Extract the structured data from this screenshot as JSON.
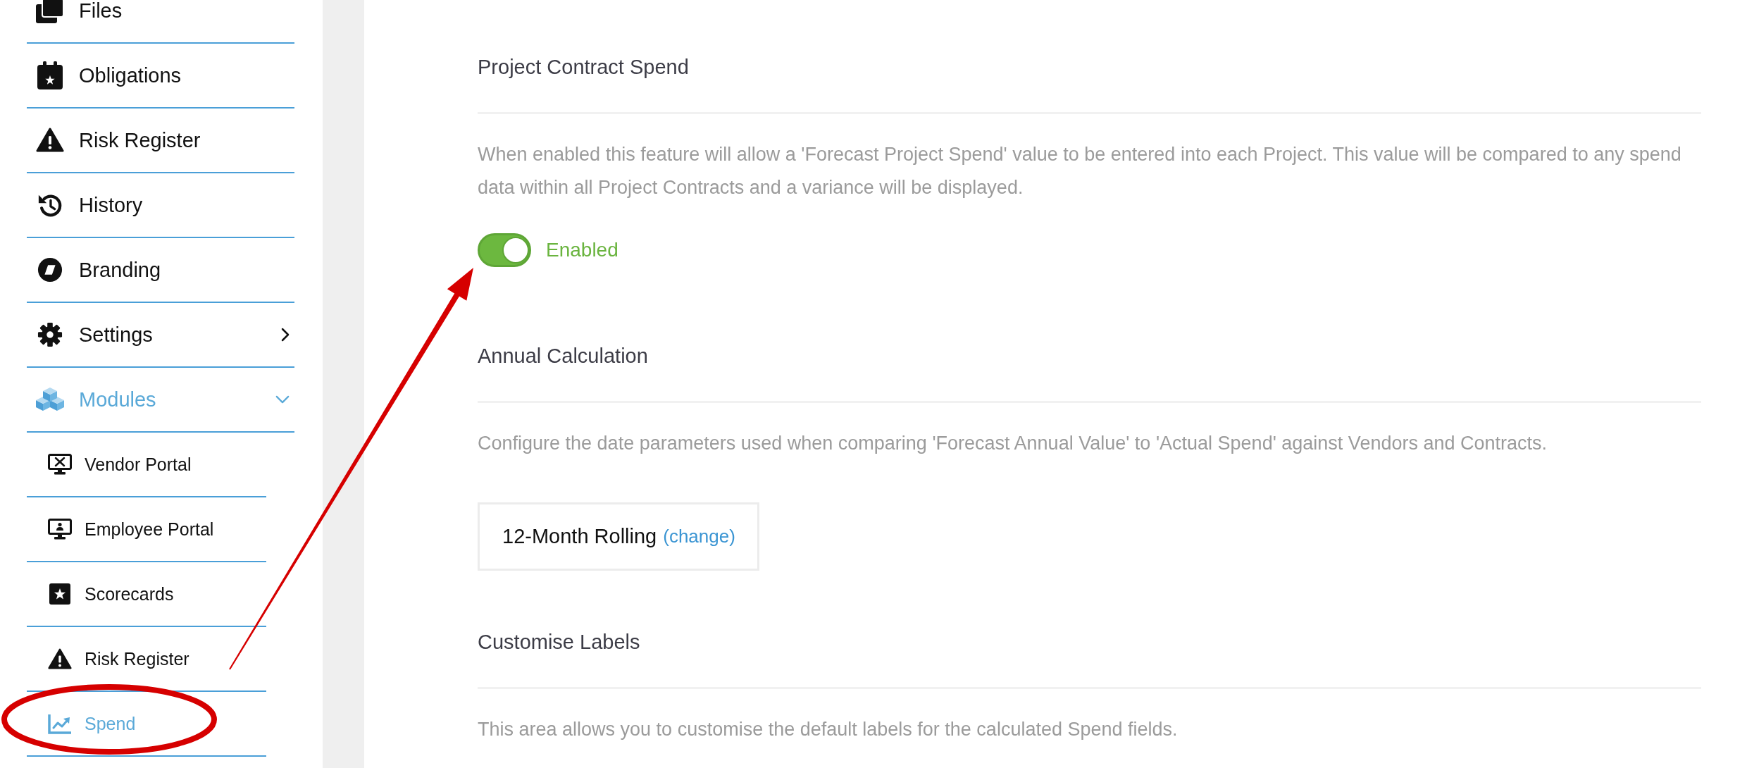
{
  "sidebar": {
    "items": [
      {
        "label": "Files",
        "selected": false
      },
      {
        "label": "Obligations",
        "selected": false
      },
      {
        "label": "Risk Register",
        "selected": false
      },
      {
        "label": "History",
        "selected": false
      },
      {
        "label": "Branding",
        "selected": false
      },
      {
        "label": "Settings",
        "selected": false,
        "expanded": false
      },
      {
        "label": "Modules",
        "selected": true,
        "expanded": true,
        "children": [
          {
            "label": "Vendor Portal",
            "selected": false
          },
          {
            "label": "Employee Portal",
            "selected": false
          },
          {
            "label": "Scorecards",
            "selected": false
          },
          {
            "label": "Risk Register",
            "selected": false
          },
          {
            "label": "Spend",
            "selected": true
          }
        ]
      }
    ]
  },
  "sections": [
    {
      "kind": "toggle",
      "title": "Project Contract Spend",
      "description": "When enabled this feature will allow a 'Forecast Project Spend' value to be entered into each Project. This value will be compared to any spend data within all Project Contracts and a variance will be displayed.",
      "toggle": {
        "on": true,
        "label": "Enabled"
      }
    },
    {
      "kind": "value",
      "title": "Annual Calculation",
      "description": "Configure the date parameters used when comparing 'Forecast Annual Value' to 'Actual Spend' against Vendors and Contracts.",
      "value": {
        "text": "12-Month Rolling",
        "link": "(change)"
      }
    },
    {
      "kind": "text",
      "title": "Customise Labels",
      "description": "This area allows you to customise the default labels for the calculated Spend fields."
    }
  ],
  "annotations": {
    "highlight_ellipse": true,
    "pointer_arrow": true
  }
}
